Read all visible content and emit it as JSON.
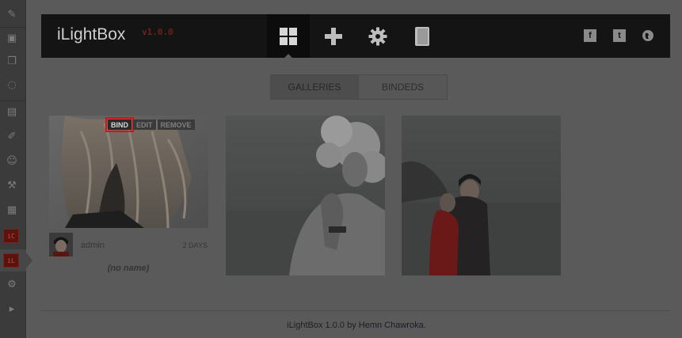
{
  "app": {
    "title": "iLightBox",
    "version": "v1.0.0"
  },
  "nav": {
    "buttons": [
      {
        "icon": "grid-icon",
        "active": true
      },
      {
        "icon": "plus-icon",
        "active": false
      },
      {
        "icon": "gear-icon",
        "active": false
      },
      {
        "icon": "book-icon",
        "active": false
      }
    ],
    "social": [
      "facebook-icon",
      "twitter-icon",
      "globe-icon"
    ]
  },
  "tabs": [
    {
      "label": "GALLERIES",
      "active": true
    },
    {
      "label": "BINDEDS",
      "active": false
    }
  ],
  "card_actions": {
    "bind": "BIND",
    "edit": "EDIT",
    "remove": "REMOVE"
  },
  "gallery": {
    "author": "admin",
    "age": "2 DAYS",
    "name": "(no name)"
  },
  "footer": {
    "prefix": "iLightBox 1.0.0 by ",
    "author": "Hemn Chawroka",
    "suffix": "."
  },
  "colors": {
    "highlight": "#d11111",
    "banner": "#141414"
  }
}
